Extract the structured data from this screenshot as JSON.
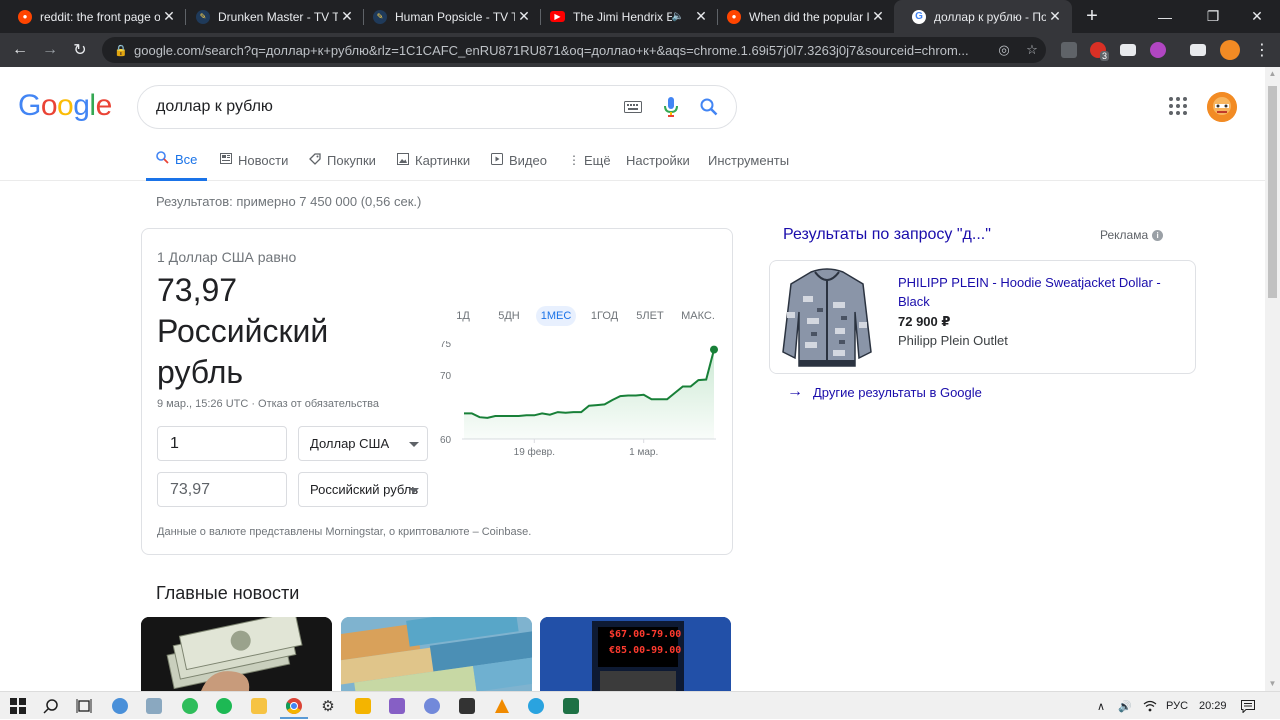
{
  "browser": {
    "tabs": [
      {
        "title": "reddit: the front page o",
        "icon": "reddit-icon",
        "color": "#ff4500"
      },
      {
        "title": "Drunken Master - TV Tr",
        "icon": "tvtropes-icon",
        "color": "#3b6eb4"
      },
      {
        "title": "Human Popsicle - TV Tr",
        "icon": "tvtropes-icon",
        "color": "#3b6eb4"
      },
      {
        "title": "The Jimi Hendrix Ex",
        "icon": "youtube-icon",
        "color": "#ff0000"
      },
      {
        "title": "When did the popular I",
        "icon": "reddit-icon",
        "color": "#ff4500"
      },
      {
        "title": "доллар к рублю - Пои",
        "icon": "google-icon",
        "color": "#4285f4"
      }
    ],
    "new_tab": "+",
    "url": "google.com/search?q=доллар+к+рублю&rlz=1C1CAFC_enRU871RU871&oq=доллао+к+&aqs=chrome.1.69i57j0l7.3263j0j7&sourceid=chrom...",
    "extension_badge": "3"
  },
  "google": {
    "logo": [
      "G",
      "o",
      "o",
      "g",
      "l",
      "e"
    ],
    "logo_colors": [
      "#4285f4",
      "#ea4335",
      "#fbbc05",
      "#4285f4",
      "#34a853",
      "#ea4335"
    ],
    "query": "доллар к рублю",
    "nav": [
      {
        "label": "Все",
        "icon": "search-icon"
      },
      {
        "label": "Новости",
        "icon": "news-icon"
      },
      {
        "label": "Покупки",
        "icon": "tag-icon"
      },
      {
        "label": "Картинки",
        "icon": "image-icon"
      },
      {
        "label": "Видео",
        "icon": "play-icon"
      },
      {
        "label": "Ещё",
        "icon": "more-vert-icon"
      },
      {
        "label": "Настройки",
        "icon": ""
      },
      {
        "label": "Инструменты",
        "icon": ""
      }
    ],
    "stats": "Результатов: примерно 7 450 000 (0,56 сек.)"
  },
  "converter": {
    "equals_text": "1 Доллар США равно",
    "value": "73,97 Российский рубль",
    "date": "9 мар., 15:26 UTC",
    "date_sep": "·",
    "disclaimer": "Отказ от обязательства",
    "from_amount": "1",
    "from_currency": "Доллар США",
    "to_amount": "73,97",
    "to_currency": "Российский рубль",
    "footer": "Данные о валюте представлены Morningstar, о криптовалюте – Coinbase.",
    "ranges": [
      "1Д",
      "5ДН",
      "1МЕС",
      "1ГОД",
      "5ЛЕТ",
      "МАКС."
    ],
    "active_range": "1МЕС"
  },
  "chart_data": {
    "type": "area",
    "title": "",
    "xlabel": "",
    "ylabel": "",
    "ylim": [
      60,
      75
    ],
    "yticks": [
      75,
      70,
      60
    ],
    "xticks": [
      "19 февр.",
      "1 мар."
    ],
    "color": "#188038",
    "series": [
      {
        "values": [
          64.0,
          64.0,
          63.4,
          63.3,
          63.6,
          63.6,
          63.6,
          63.6,
          63.7,
          63.7,
          64.0,
          63.8,
          64.2,
          64.1,
          64.2,
          64.2,
          65.2,
          65.3,
          65.4,
          66.1,
          66.7,
          66.8,
          66.8,
          66.9,
          66.2,
          66.2,
          66.2,
          67.2,
          68.2,
          68.2,
          69.2,
          69.3,
          73.97
        ]
      }
    ]
  },
  "ads": {
    "title": "Результаты по запросу \"д...\"",
    "label": "Реклама",
    "info": "i",
    "item": {
      "title": "PHILIPP PLEIN - Hoodie Sweatjacket Dollar - Black",
      "price": "72 900 ₽",
      "store": "Philipp Plein Outlet"
    },
    "more": "Другие результаты в Google"
  },
  "news": {
    "heading": "Главные новости",
    "sign_line1": "$67.00-79.00",
    "sign_line2": "€85.00-99.00"
  },
  "taskbar": {
    "lang": "РУС",
    "time": "20:29"
  }
}
